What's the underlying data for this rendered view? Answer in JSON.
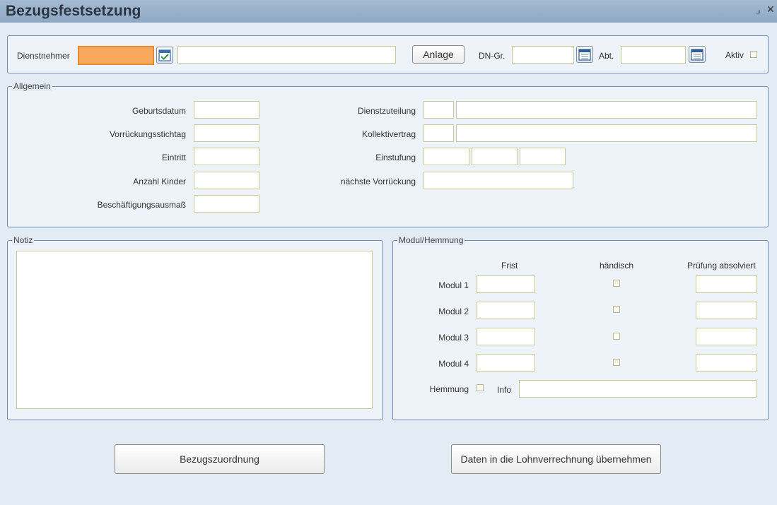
{
  "window": {
    "title": "Bezugsfestsetzung",
    "minimize_glyph": "⌟",
    "close_glyph": "✕"
  },
  "header": {
    "dienstnehmer_label": "Dienstnehmer",
    "dienstnehmer_id": "",
    "dienstnehmer_name": "",
    "anlage_button": "Anlage",
    "dn_gr_label": "DN-Gr.",
    "dn_gr_value": "",
    "abt_label": "Abt.",
    "abt_value": "",
    "aktiv_label": "Aktiv",
    "aktiv_checked": false
  },
  "allgemein": {
    "legend": "Allgemein",
    "geburtsdatum_label": "Geburtsdatum",
    "vorrueckungsstichtag_label": "Vorrückungsstichtag",
    "eintritt_label": "Eintritt",
    "anzahl_kinder_label": "Anzahl Kinder",
    "beschaeftigungsausmass_label": "Beschäftigungsausmaß",
    "dienstzuteilung_label": "Dienstzuteilung",
    "kollektivvertrag_label": "Kollektivertrag",
    "einstufung_label": "Einstufung",
    "naechste_vorrueckung_label": "nächste Vorrückung"
  },
  "notiz": {
    "legend": "Notiz",
    "text": ""
  },
  "modul_hemmung": {
    "legend": "Modul/Hemmung",
    "col_frist": "Frist",
    "col_haendisch": "händisch",
    "col_pruefung": "Prüfung absolviert",
    "modules": [
      {
        "label": "Modul 1"
      },
      {
        "label": "Modul 2"
      },
      {
        "label": "Modul 3"
      },
      {
        "label": "Modul 4"
      }
    ],
    "hemmung_label": "Hemmung",
    "info_label": "Info"
  },
  "footer": {
    "bezugszuordnung_button": "Bezugszuordnung",
    "uebernehmen_button": "Daten in die Lohnverrechnung übernehmen"
  },
  "colors": {
    "active_field": "#f7a85c",
    "titlebar": "#9bb2cc",
    "panel_border": "#6d8fb5"
  },
  "icons": {
    "lookup_button": "checklist-icon",
    "calendar_button": "calendar-icon"
  }
}
